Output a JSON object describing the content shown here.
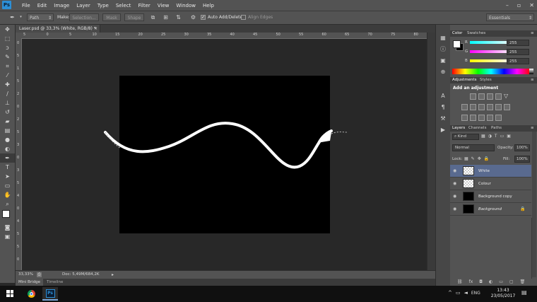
{
  "app": {
    "logo": "Ps",
    "menu": [
      "File",
      "Edit",
      "Image",
      "Layer",
      "Type",
      "Select",
      "Filter",
      "View",
      "Window",
      "Help"
    ]
  },
  "options": {
    "mode": "Path",
    "make_label": "Make:",
    "selection_label": "Selection...",
    "mask_label": "Mask",
    "shape_label": "Shape",
    "auto_add_delete": "Auto Add/Delete",
    "align_edges": "Align Edges",
    "workspace": "Essentials"
  },
  "document": {
    "tab_title": "Laser.psd @ 33,3% (White, RGB/8) *",
    "zoom": "33,33%",
    "doc_size": "Doc: 5,49M/684,2K"
  },
  "rulers": {
    "h_ticks": [
      "5",
      "0",
      "5",
      "10",
      "15",
      "20",
      "25",
      "30",
      "35",
      "40",
      "45",
      "50",
      "55",
      "60",
      "65",
      "70",
      "75",
      "80"
    ],
    "v_ticks": [
      "0",
      "5",
      "1",
      "5",
      "2",
      "0",
      "2",
      "5",
      "3",
      "0",
      "3",
      "5",
      "4",
      "0",
      "4",
      "5",
      "5",
      "0"
    ]
  },
  "bottom_tabs": [
    "Mini Bridge",
    "Timeline"
  ],
  "color_panel": {
    "tabs": [
      "Color",
      "Swatches"
    ],
    "r_label": "R",
    "r_value": "255",
    "g_label": "G",
    "g_value": "255",
    "b_label": "B",
    "b_value": "255"
  },
  "adjustments_panel": {
    "tabs": [
      "Adjustments",
      "Styles"
    ],
    "heading": "Add an adjustment"
  },
  "layers_panel": {
    "tabs": [
      "Layers",
      "Channels",
      "Paths"
    ],
    "kind": "Kind",
    "blend_mode": "Normal",
    "opacity_label": "Opacity:",
    "opacity_value": "100%",
    "lock_label": "Lock:",
    "fill_label": "Fill:",
    "fill_value": "100%",
    "layers": [
      {
        "name": "White",
        "thumb": "check",
        "selected": true,
        "italic": false
      },
      {
        "name": "Colour",
        "thumb": "check",
        "selected": false,
        "italic": false
      },
      {
        "name": "Background copy",
        "thumb": "black",
        "selected": false,
        "italic": false
      },
      {
        "name": "Background",
        "thumb": "black",
        "selected": false,
        "italic": true
      }
    ]
  },
  "taskbar": {
    "lang": "ENG",
    "time": "13:43",
    "date": "23/05/2017"
  },
  "colors": {
    "accent_selected_layer": "#596a8f",
    "photoshop_blue": "#2c8fd6"
  }
}
